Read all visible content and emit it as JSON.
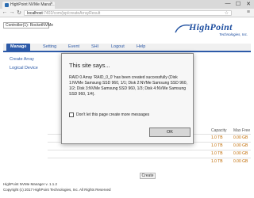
{
  "browser": {
    "tab_title": "HighPoint NVMe Mana…",
    "address_host": "localhost",
    "address_path": ":7402/com/jsp/createArrayResult",
    "minimize": "—",
    "maximize": "☐",
    "close": "✕"
  },
  "header": {
    "controller_label": "Controller(1): RocketNVMe",
    "logo_text": "HighPoint",
    "logo_sub": "Technologies, Inc.",
    "brand_color": "#1f4fa0"
  },
  "nav": {
    "tabs": [
      {
        "label": "Manage",
        "active": true
      },
      {
        "label": "Setting",
        "active": false
      },
      {
        "label": "Event",
        "active": false
      },
      {
        "label": "SHI",
        "active": false
      },
      {
        "label": "Logout",
        "active": false
      },
      {
        "label": "Help",
        "active": false
      }
    ]
  },
  "sidebar": {
    "items": [
      {
        "label": "Create Array"
      },
      {
        "label": "Logical Device"
      }
    ]
  },
  "content": {
    "columns": [
      "Capacity",
      "Max Free"
    ],
    "rows": [
      [
        "1.0 TB",
        "0.00 GB"
      ],
      [
        "1.0 TB",
        "0.00 GB"
      ],
      [
        "1.0 TB",
        "0.00 GB"
      ],
      [
        "1.0 TB",
        "0.00 GB"
      ]
    ],
    "create_button": "Create",
    "accent_color": "#c06a00"
  },
  "footer": {
    "version": "HighPoint NVMe Manager v. 1.1.2",
    "copyright": "Copyright (c) 2017 HighPoint Technologies, Inc. All Rights Reserved"
  },
  "dialog": {
    "title": "This site says...",
    "message": "RAID 0 Array 'RAID_0_0' has been created successfully (Disk 1:NVMe Samsung SSD 960, 1/1; Disk 2:NVMe Samsung SSD 960, 1/2; Disk 3:NVMe Samsung SSD 960, 1/3; Disk 4:NVMe Samsung SSD 960, 1/4).",
    "checkbox_label": "Don't let this page create more messages",
    "ok_label": "OK"
  }
}
